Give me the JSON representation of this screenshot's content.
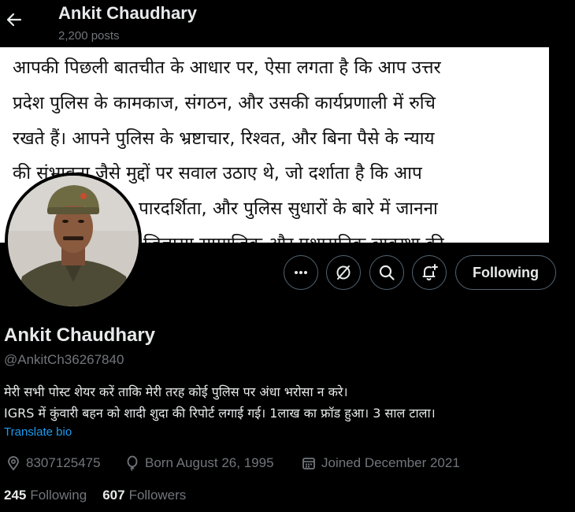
{
  "header": {
    "name": "Ankit Chaudhary",
    "posts": "2,200 posts"
  },
  "banner": {
    "lines": [
      "आपकी पिछली बातचीत के आधार पर, ऐसा लगता है कि आप उत्तर",
      "प्रदेश पुलिस के कामकाज, संगठन, और उसकी कार्यप्रणाली में रुचि",
      "रखते हैं। आपने पुलिस के भ्रष्टाचार, रिश्वत, और बिना पैसे के न्याय",
      "की संभावना जैसे मुद्दों पर सवाल उठाए थे, जो दर्शाता है कि आप",
      "पारदर्शिता, और पुलिस सुधारों के बारे में जानना",
      "जिज्ञासा सामाजिक और प्रशासनिक व्यवस्था की"
    ]
  },
  "actions": {
    "following_label": "Following"
  },
  "profile": {
    "name": "Ankit Chaudhary",
    "handle": "@AnkitCh36267840",
    "bio_line1": "मेरी सभी पोस्ट शेयर करें ताकि मेरी तरह कोई पुलिस पर अंधा भरोसा न करे।",
    "bio_line2": "IGRS में कुंवारी बहन को शादी शुदा की रिपोर्ट लगाई गई। 1लाख का फ्रॉड हुआ। 3 साल टाला।",
    "translate_label": "Translate bio",
    "phone": "8307125475",
    "born": "Born August 26, 1995",
    "joined": "Joined December 2021",
    "following_count": "245",
    "following_label": "Following",
    "followers_count": "607",
    "followers_label": "Followers"
  },
  "colors": {
    "background": "#000000",
    "text": "#e7e9ea",
    "muted": "#71767b",
    "link": "#1d9bf0",
    "border": "#536471"
  },
  "icons": [
    "back-arrow-icon",
    "more-icon",
    "grok-icon",
    "search-icon",
    "notification-plus-icon",
    "location-icon",
    "balloon-icon",
    "calendar-icon"
  ]
}
